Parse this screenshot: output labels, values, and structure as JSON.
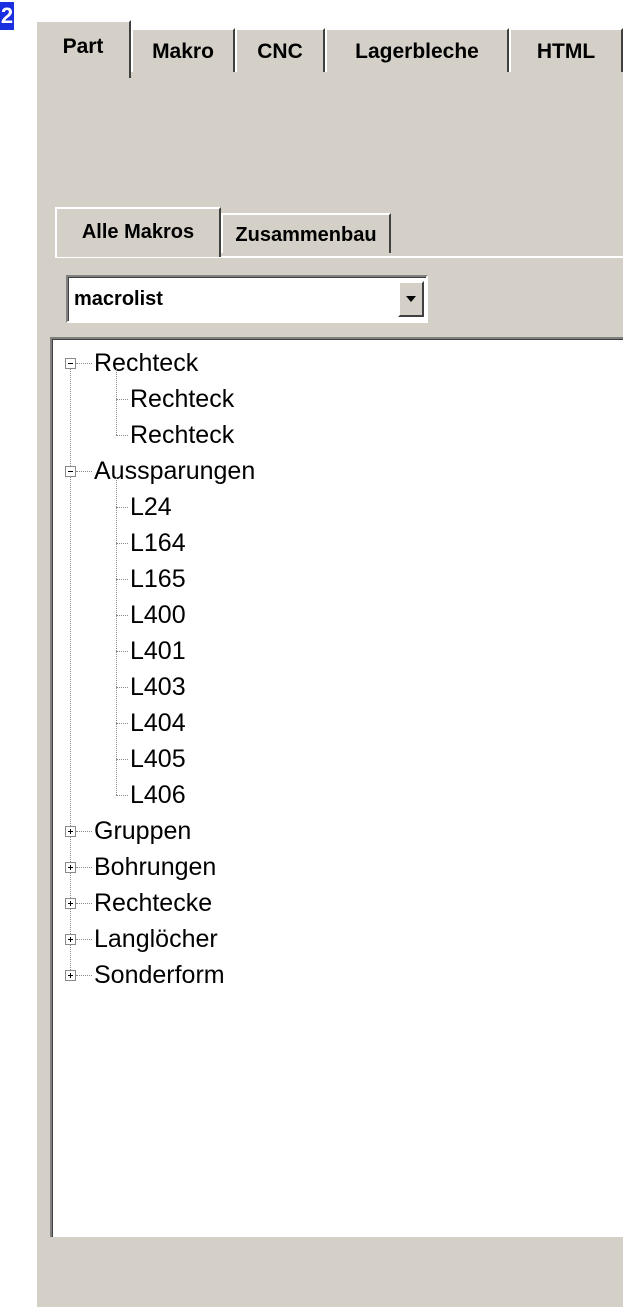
{
  "marker": "2",
  "main_tabs": [
    {
      "label": "Part",
      "active": true
    },
    {
      "label": "Makro",
      "active": false
    },
    {
      "label": "CNC",
      "active": false
    },
    {
      "label": "Lagerbleche",
      "active": false
    },
    {
      "label": "HTML",
      "active": false
    }
  ],
  "sub_tabs": [
    {
      "label": "Alle Makros",
      "active": true
    },
    {
      "label": "Zusammenbau",
      "active": false
    }
  ],
  "macro_select": {
    "value": "macrolist"
  },
  "tree": [
    {
      "label": "Rechteck",
      "expanded": true,
      "children": [
        "Rechteck",
        "Rechteck"
      ]
    },
    {
      "label": "Aussparungen",
      "expanded": true,
      "children": [
        "L24",
        "L164",
        "L165",
        "L400",
        "L401",
        "L403",
        "L404",
        "L405",
        "L406"
      ]
    },
    {
      "label": "Gruppen",
      "expanded": false,
      "children": []
    },
    {
      "label": "Bohrungen",
      "expanded": false,
      "children": []
    },
    {
      "label": "Rechtecke",
      "expanded": false,
      "children": []
    },
    {
      "label": "Langlöcher",
      "expanded": false,
      "children": []
    },
    {
      "label": "Sonderform",
      "expanded": false,
      "children": []
    }
  ],
  "colors": {
    "face": "#d4d0c8",
    "marker": "#1a2fe0"
  }
}
